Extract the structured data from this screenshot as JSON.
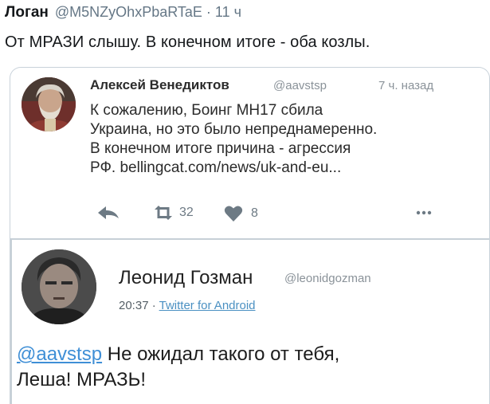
{
  "outer_tweet": {
    "author_name": "Логан",
    "author_handle": "@M5NZyOhxPbaRTaE",
    "separator": "·",
    "time": "11 ч",
    "text": "От МРАЗИ слышу. В конечном итоге - оба козлы."
  },
  "quoted_tweet_a": {
    "author_name": "Алексей Венедиктов",
    "author_handle": "@aavstsp",
    "time": "7 ч. назад",
    "text_lines": [
      "К сожалению, Боинг МН17 сбила",
      "Украина, но это было непреднамеренно.",
      "В конечном итоге причина - агрессия",
      "РФ.  bellingcat.com/news/uk-and-eu..."
    ],
    "actions": {
      "retweet_count": "32",
      "like_count": "8",
      "icons": [
        "reply-icon",
        "retweet-icon",
        "heart-icon",
        "more-icon"
      ]
    }
  },
  "quoted_tweet_b": {
    "author_name": "Леонид Гозман",
    "author_handle": "@leonidgozman",
    "time": "20:37",
    "meta_separator": "·",
    "via": "Twitter for Android",
    "mention": "@aavstsp",
    "text_line1_rest": " Не ожидал такого от тебя,",
    "text_line2": "Леша! МРАЗЬ!"
  },
  "colors": {
    "link": "#3f8fd6",
    "muted": "#657786",
    "divider": "#c7d0d7"
  }
}
